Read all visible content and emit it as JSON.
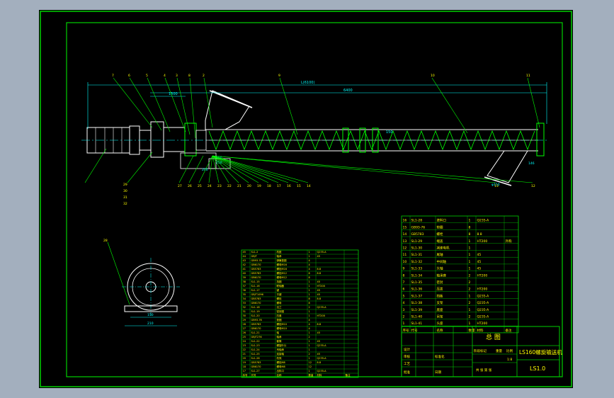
{
  "colors": {
    "background": "#a3afbe",
    "sheet": "#000000",
    "border": "#00e000",
    "geometry": "#ffffff",
    "dimension": "#00ffff",
    "leader": "#00ff00",
    "text": "#ffff00",
    "title_text": "#ffff00"
  },
  "dimensions": {
    "overall": "L(6100)",
    "inner": "6400",
    "motor_offset": "1500",
    "pitch": "150",
    "small_a": "150",
    "small_b": "250",
    "small_c": "200",
    "outlet_width": "φ150",
    "outlet_h": "146",
    "end_view_width": "150",
    "end_view_span": "210"
  },
  "part_callouts_top": [
    "7",
    "6",
    "5",
    "4",
    "3",
    "8",
    "2",
    "9",
    "10",
    "11"
  ],
  "part_callouts_bottom": [
    "27",
    "26",
    "25",
    "24",
    "23",
    "22",
    "21",
    "20",
    "19",
    "18",
    "17",
    "16",
    "15",
    "14",
    "13",
    "12"
  ],
  "part_callouts_left": [
    "29",
    "30",
    "31",
    "32"
  ],
  "end_view_callout": "28",
  "parts_list_left": {
    "rows": [
      [
        "45",
        "SL1-2",
        "机座",
        "1",
        "Q235-A",
        ""
      ],
      [
        "44",
        "GB/T",
        "轴承",
        "1",
        "45",
        ""
      ],
      [
        "43",
        "GB93-76",
        "弹簧垫圈",
        "4",
        "",
        ""
      ],
      [
        "42",
        "GB6170",
        "螺母M16",
        "4",
        "",
        ""
      ],
      [
        "41",
        "GB5783",
        "螺栓M16",
        "4",
        "8.8",
        ""
      ],
      [
        "40",
        "GB5783",
        "螺栓M12",
        "8",
        "8.8",
        ""
      ],
      [
        "39",
        "GB6170",
        "螺母M12",
        "8",
        "",
        ""
      ],
      [
        "38",
        "SL1-15",
        "挡圈",
        "1",
        "45",
        ""
      ],
      [
        "37",
        "SL1-16",
        "联轴器",
        "1",
        "HT200",
        ""
      ],
      [
        "36",
        "SL1-17",
        "键",
        "1",
        "45",
        ""
      ],
      [
        "35",
        "GB/T1096",
        "平键",
        "1",
        "45",
        ""
      ],
      [
        "34",
        "GB5783",
        "螺栓",
        "8",
        "8.8",
        ""
      ],
      [
        "33",
        "GB6170",
        "螺母",
        "8",
        "",
        ""
      ],
      [
        "32",
        "SL1-18",
        "法兰",
        "2",
        "Q235-A",
        ""
      ],
      [
        "31",
        "SL1-19",
        "密封圈",
        "1",
        "",
        ""
      ],
      [
        "30",
        "SL1-20",
        "压盖",
        "1",
        "HT200",
        ""
      ],
      [
        "29",
        "GB93-76",
        "垫圈",
        "4",
        "",
        ""
      ],
      [
        "28",
        "GB5783",
        "螺栓M10",
        "4",
        "8.8",
        ""
      ],
      [
        "27",
        "GB6170",
        "螺母M10",
        "4",
        "",
        ""
      ],
      [
        "26",
        "SL1-21",
        "轴",
        "1",
        "45",
        ""
      ],
      [
        "25",
        "GB/T276",
        "轴承",
        "2",
        "",
        ""
      ],
      [
        "24",
        "SL1-22",
        "套筒",
        "1",
        "45",
        ""
      ],
      [
        "23",
        "SL1-23",
        "螺旋叶片",
        "1",
        "Q235-A",
        ""
      ],
      [
        "22",
        "SL1-24",
        "吊轴承",
        "1",
        "",
        ""
      ],
      [
        "21",
        "SL1-25",
        "连接轴",
        "2",
        "45",
        ""
      ],
      [
        "20",
        "SL1-26",
        "机壳",
        "1",
        "Q235-A",
        ""
      ],
      [
        "19",
        "GB5783",
        "螺栓M8",
        "12",
        "8.8",
        ""
      ],
      [
        "18",
        "GB6170",
        "螺母M8",
        "12",
        "",
        ""
      ],
      [
        "17",
        "SL1-27",
        "出料口",
        "1",
        "Q235-A",
        ""
      ]
    ],
    "header": [
      "序号",
      "代号",
      "名称",
      "数量",
      "材料",
      "备注"
    ]
  },
  "parts_list_right": {
    "rows": [
      [
        "16",
        "SL1-28",
        "进料口",
        "1",
        "Q235-A",
        ""
      ],
      [
        "15",
        "GB93-76",
        "垫圈",
        "8",
        "",
        ""
      ],
      [
        "14",
        "GB5783",
        "螺栓",
        "8",
        "8.8",
        ""
      ],
      [
        "13",
        "SL1-29",
        "端盖",
        "1",
        "HT200",
        "外购"
      ],
      [
        "12",
        "SL1-30",
        "减速电机",
        "1",
        "",
        ""
      ],
      [
        "11",
        "SL1-31",
        "尾轴",
        "1",
        "45",
        ""
      ],
      [
        "10",
        "SL1-32",
        "中间轴",
        "1",
        "45",
        ""
      ],
      [
        "9",
        "SL1-33",
        "头轴",
        "1",
        "45",
        ""
      ],
      [
        "8",
        "SL1-34",
        "轴承座",
        "2",
        "HT200",
        ""
      ],
      [
        "7",
        "SL1-35",
        "密封",
        "2",
        "",
        ""
      ],
      [
        "6",
        "SL1-36",
        "压盖",
        "2",
        "HT200",
        ""
      ],
      [
        "5",
        "SL1-37",
        "挡板",
        "1",
        "Q235-A",
        ""
      ],
      [
        "4",
        "SL1-38",
        "支架",
        "2",
        "Q235-A",
        ""
      ],
      [
        "3",
        "SL1-39",
        "底座",
        "1",
        "Q235-A",
        ""
      ],
      [
        "2",
        "SL1-40",
        "吊架",
        "2",
        "Q235-A",
        ""
      ],
      [
        "1",
        "SL1-41",
        "头座",
        "1",
        "HT200",
        ""
      ]
    ],
    "header": [
      "序号",
      "代号",
      "名称",
      "数量",
      "材料",
      "备注"
    ]
  },
  "title_block": {
    "view_name": "总 图",
    "drawing_title": "LS160螺旋输送机",
    "drawing_number": "LS1.0",
    "scale": "1:8",
    "sheet_row": "共 张  第 张",
    "stage_label": "阶段标记",
    "weight_label": "重量",
    "scale_label": "比例",
    "designer": "设计",
    "checker": "审核",
    "craft": "工艺",
    "approve": "批准",
    "std": "标准化",
    "date": "日期"
  }
}
